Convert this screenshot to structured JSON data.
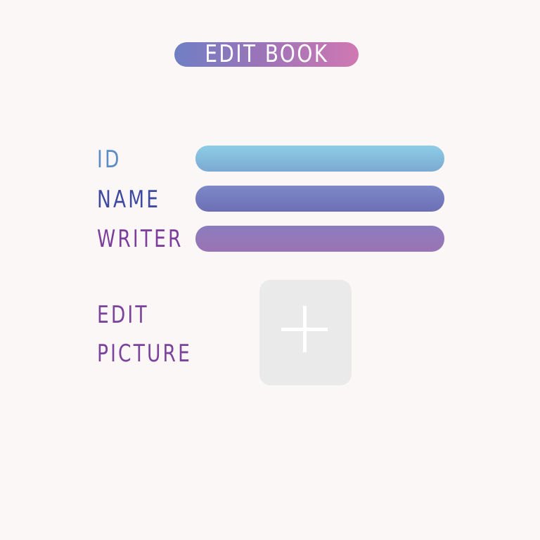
{
  "header": {
    "title": "EDIT BOOK"
  },
  "form": {
    "id": {
      "label": "ID",
      "value": ""
    },
    "name": {
      "label": "NAME",
      "value": ""
    },
    "writer": {
      "label": "WRITER",
      "value": ""
    },
    "picture": {
      "label_line1": "EDIT",
      "label_line2": "PICTURE",
      "icon": "plus-icon"
    }
  },
  "colors": {
    "background": "#fcf7f7",
    "title_gradient_start": "#6f7fc4",
    "title_gradient_end": "#d078b2",
    "id_label": "#5b8cc4",
    "name_label": "#3e4aa0",
    "writer_label": "#7d3d9c",
    "picture_label": "#7a449a",
    "picture_box": "#ebeaeb"
  }
}
